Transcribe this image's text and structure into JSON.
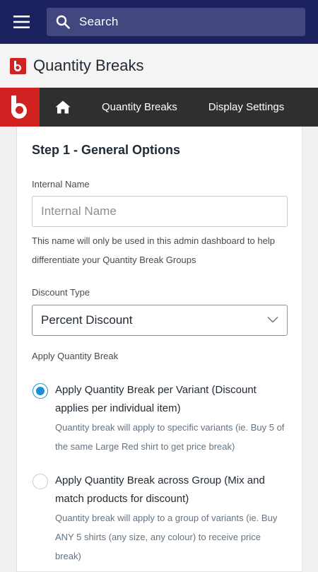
{
  "search": {
    "placeholder": "Search"
  },
  "app": {
    "title": "Quantity Breaks"
  },
  "nav": {
    "items": [
      {
        "label": "Quantity Breaks"
      },
      {
        "label": "Display Settings"
      }
    ]
  },
  "form": {
    "step_title": "Step 1 - General Options",
    "internal_name": {
      "label": "Internal Name",
      "placeholder": "Internal Name",
      "value": "",
      "help": "This name will only be used in this admin dashboard to help differentiate your Quantity Break Groups"
    },
    "discount_type": {
      "label": "Discount Type",
      "selected": "Percent Discount"
    },
    "apply": {
      "label": "Apply Quantity Break",
      "options": [
        {
          "title": "Apply Quantity Break per Variant (Discount applies per individual item)",
          "description": "Quantity break will apply to specific variants (ie. Buy 5 of the same Large Red shirt to get price break)",
          "checked": true
        },
        {
          "title": "Apply Quantity Break across Group (Mix and match products for discount)",
          "description": "Quantity break will apply to a group of variants (ie. Buy ANY 5 shirts (any size, any colour) to receive price break)",
          "checked": false
        }
      ]
    }
  },
  "colors": {
    "topbar": "#1c2260",
    "search_bg": "#42477f",
    "nav_bg": "#2f2f2f",
    "brand_red": "#d12222",
    "radio_accent": "#1b8fd6"
  },
  "icons": {
    "menu": "hamburger-icon",
    "search": "search-icon",
    "logo": "app-logo-icon",
    "home": "home-icon",
    "select_caret": "chevron-down-icon"
  }
}
